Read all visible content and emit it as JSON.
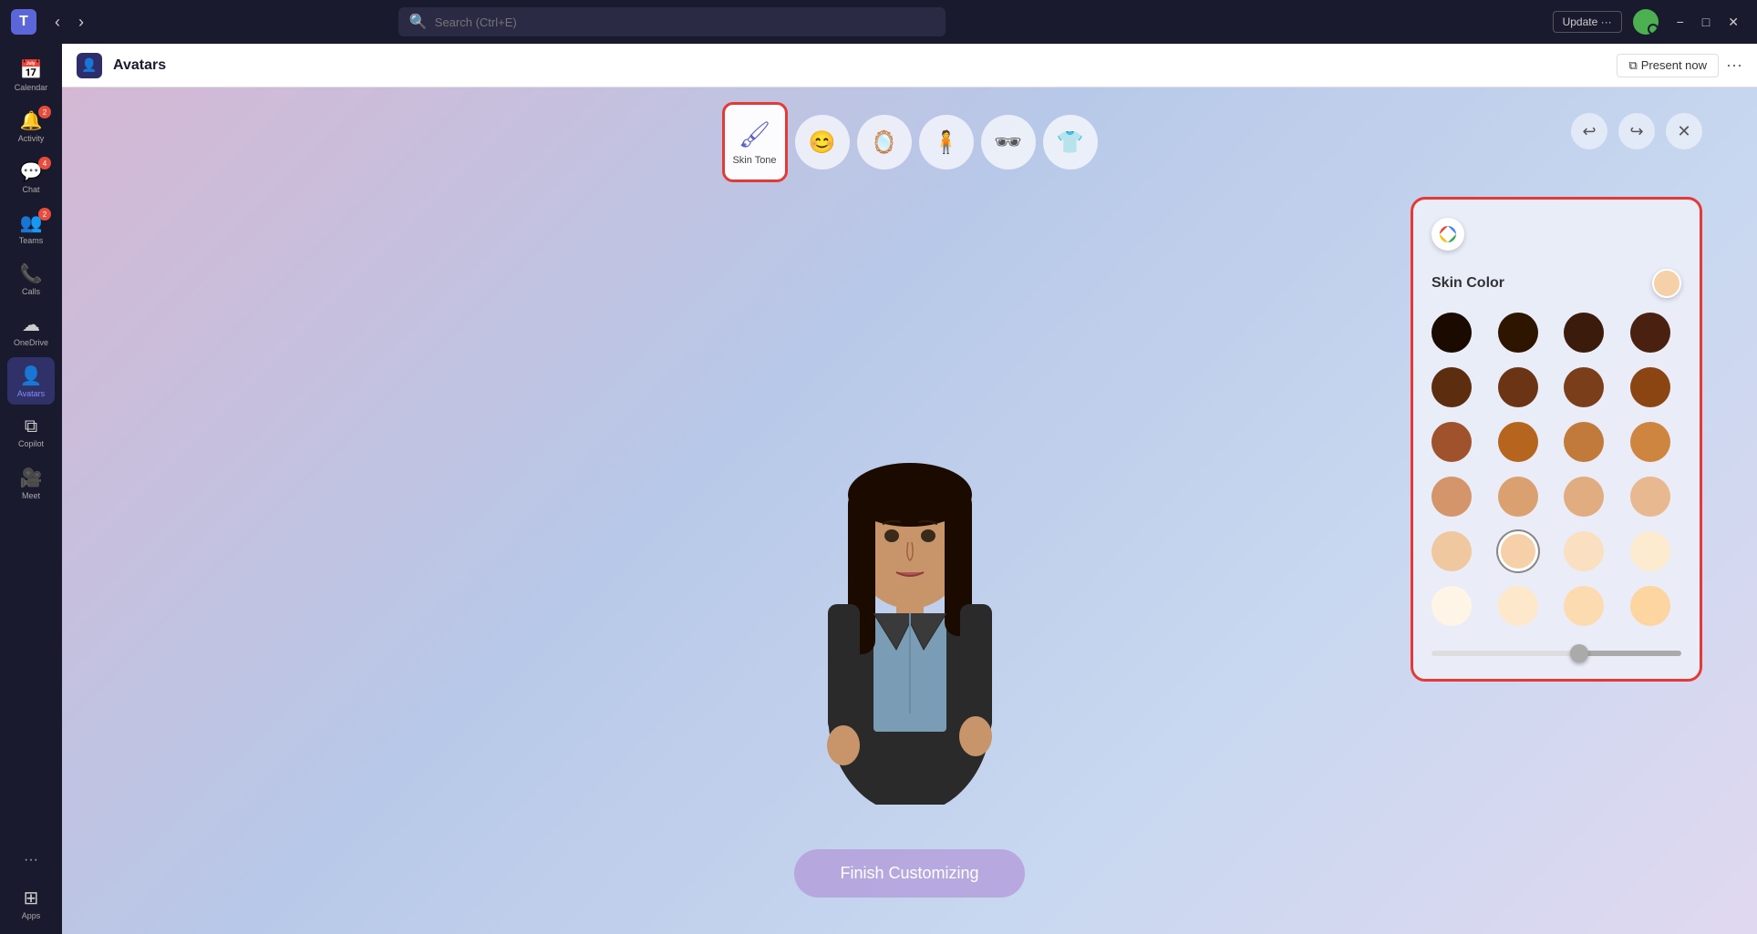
{
  "titleBar": {
    "logo": "T",
    "backLabel": "‹",
    "forwardLabel": "›",
    "search": {
      "placeholder": "Search (Ctrl+E)"
    },
    "updateButton": "Update ···",
    "minimize": "−",
    "maximize": "□",
    "close": "✕"
  },
  "sidebar": {
    "items": [
      {
        "id": "calendar",
        "label": "Calendar",
        "icon": "📅",
        "badge": null,
        "active": false
      },
      {
        "id": "activity",
        "label": "Activity",
        "icon": "🔔",
        "badge": "2",
        "active": false
      },
      {
        "id": "chat",
        "label": "Chat",
        "icon": "💬",
        "badge": "4",
        "active": false
      },
      {
        "id": "teams",
        "label": "Teams",
        "icon": "👥",
        "badge": "2",
        "active": false
      },
      {
        "id": "calls",
        "label": "Calls",
        "icon": "📞",
        "badge": null,
        "active": false
      },
      {
        "id": "onedrive",
        "label": "OneDrive",
        "icon": "☁",
        "badge": null,
        "active": false
      },
      {
        "id": "avatars",
        "label": "Avatars",
        "icon": "👤",
        "badge": null,
        "active": true
      },
      {
        "id": "copilot",
        "label": "Copilot",
        "icon": "⧉",
        "badge": null,
        "active": false
      },
      {
        "id": "meet",
        "label": "Meet",
        "icon": "🎥",
        "badge": null,
        "active": false
      },
      {
        "id": "apps",
        "label": "Apps",
        "icon": "⊞",
        "badge": null,
        "active": false
      }
    ],
    "dotsLabel": "···"
  },
  "appHeader": {
    "icon": "👤",
    "title": "Avatars",
    "presentNow": "Present now",
    "moreOptions": "···"
  },
  "toolbar": {
    "buttons": [
      {
        "id": "skin-tone",
        "label": "Skin Tone",
        "icon": "🖌",
        "active": true
      },
      {
        "id": "face",
        "label": "",
        "icon": "😊",
        "active": false
      },
      {
        "id": "hair",
        "label": "",
        "icon": "🪞",
        "active": false
      },
      {
        "id": "body",
        "label": "",
        "icon": "🧍",
        "active": false
      },
      {
        "id": "accessories",
        "label": "",
        "icon": "🕶",
        "active": false
      },
      {
        "id": "outfit",
        "label": "",
        "icon": "👕",
        "active": false
      }
    ],
    "undoLabel": "↩",
    "redoLabel": "↪",
    "closeLabel": "✕"
  },
  "skinPanel": {
    "title": "Skin Color",
    "googleIcon": "🎨",
    "selectedColor": "#f5d0a9",
    "colors": [
      "#1a0a00",
      "#2d1500",
      "#3b1c0c",
      "#4a2010",
      "#5c2d0e",
      "#6b3515",
      "#7a3e1a",
      "#8b4513",
      "#a0522d",
      "#b5651d",
      "#c27a3a",
      "#cd853f",
      "#d4956a",
      "#daa070",
      "#e0ac80",
      "#e8b890",
      "#f0c8a0",
      "#f5d0a9",
      "#fae0c0",
      "#fdebd0",
      "#fff5e6",
      "#fde8cc",
      "#fddbb0",
      "#fcd5a0"
    ],
    "sliderValue": 60
  },
  "finishButton": "Finish Customizing"
}
